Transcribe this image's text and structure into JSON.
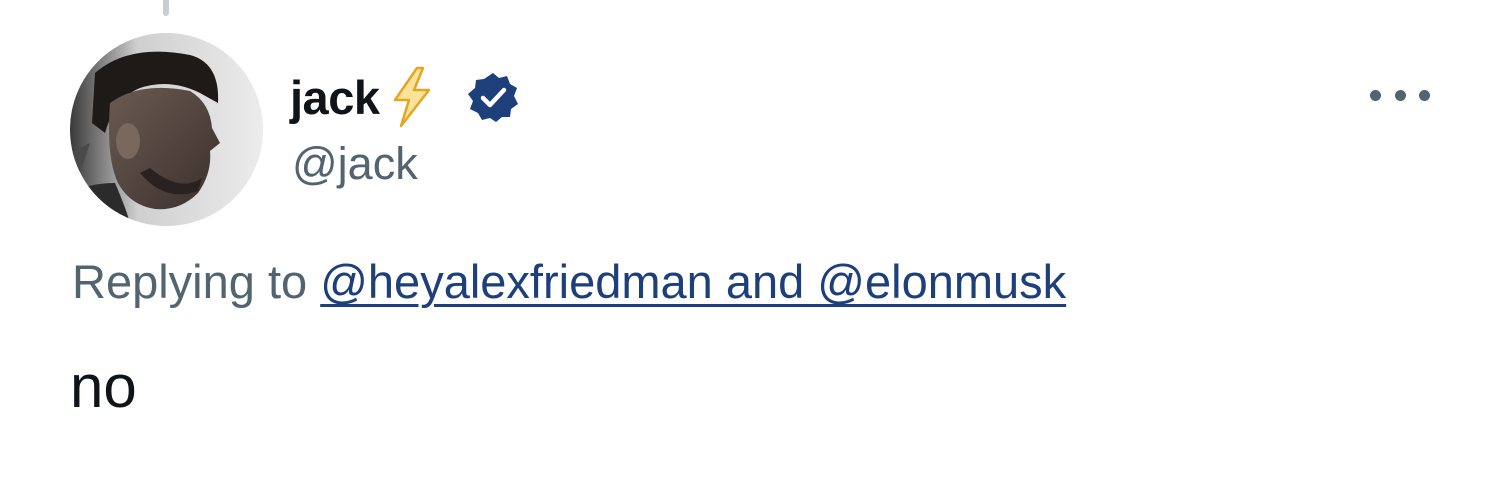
{
  "tweet": {
    "author": {
      "display_name": "jack",
      "handle": "@jack",
      "name_emoji": "lightning-bolt-icon",
      "verified_icon": "verified-badge-icon"
    },
    "replying_to": {
      "prefix": "Replying to",
      "mentions_text": "@heyalexfriedman and @elonmusk"
    },
    "text": "no",
    "menu_icon": "more-options-icon"
  },
  "colors": {
    "primary_text": "#0f1419",
    "secondary_text": "#536471",
    "link": "#1d3f7a",
    "verified_badge": "#1d3f7a",
    "bolt": "#f6c445"
  }
}
